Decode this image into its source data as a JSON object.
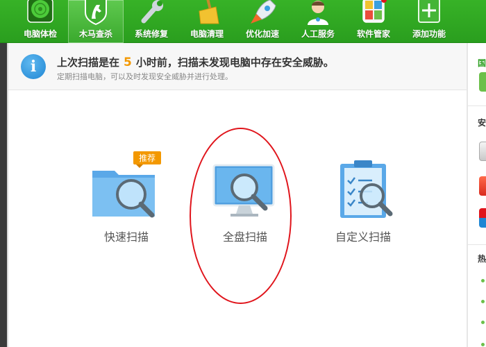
{
  "toolbar": {
    "items": [
      {
        "label": "电脑体检",
        "icon": "radar-icon"
      },
      {
        "label": "木马查杀",
        "icon": "horse-shield-icon",
        "active": true
      },
      {
        "label": "系统修复",
        "icon": "wrench-icon"
      },
      {
        "label": "电脑清理",
        "icon": "broom-icon"
      },
      {
        "label": "优化加速",
        "icon": "rocket-icon"
      },
      {
        "label": "人工服务",
        "icon": "doctor-icon"
      },
      {
        "label": "软件管家",
        "icon": "apps-icon"
      },
      {
        "label": "添加功能",
        "icon": "plus-icon"
      }
    ]
  },
  "banner": {
    "main_prefix": "上次扫描是在",
    "hours": "5",
    "main_suffix": "小时前，扫描未发现电脑中存在安全威胁。",
    "sub": "定期扫描电脑，可以及时发现安全威胁并进行处理。"
  },
  "scan": {
    "quick": "快速扫描",
    "quick_badge": "推荐",
    "full": "全盘扫描",
    "custom": "自定义扫描"
  },
  "right_panel": {
    "text1": "国",
    "text2": "安",
    "text3": "热"
  },
  "colors": {
    "toolbar_green": "#2a9e1e",
    "accent_orange": "#f39800",
    "highlight_red": "#e0141b"
  }
}
